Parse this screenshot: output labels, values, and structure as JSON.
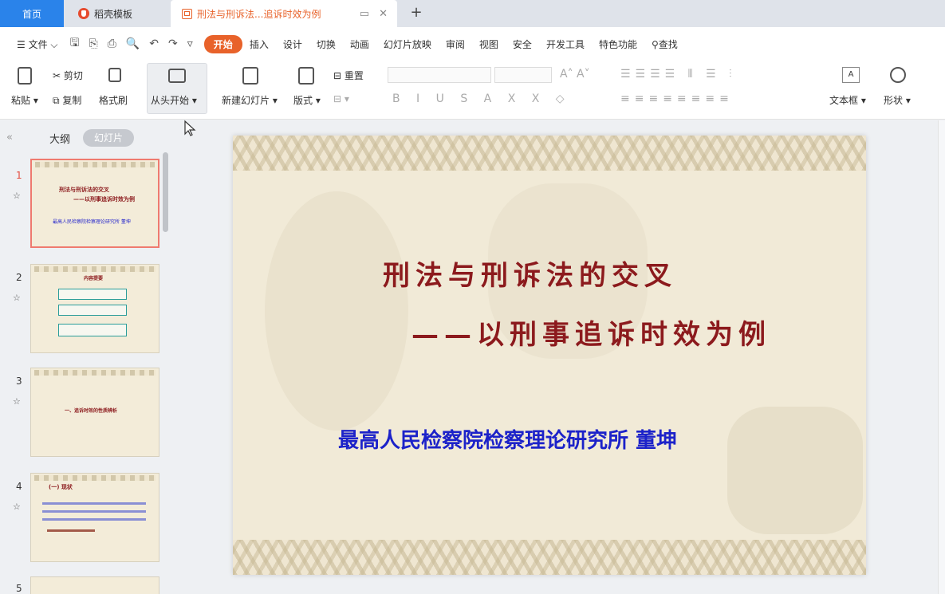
{
  "tabs": {
    "home": "首页",
    "templates": "稻壳模板",
    "doc": "刑法与刑诉法...追诉时效为例",
    "add": "+"
  },
  "menu": {
    "file": "文件",
    "items": [
      "开始",
      "插入",
      "设计",
      "切换",
      "动画",
      "幻灯片放映",
      "审阅",
      "视图",
      "安全",
      "开发工具",
      "特色功能"
    ],
    "search": "查找"
  },
  "ribbon": {
    "paste": "粘贴",
    "cut": "剪切",
    "copy": "复制",
    "format_painter": "格式刷",
    "from_start": "从头开始",
    "new_slide": "新建幻灯片",
    "layout": "版式",
    "reset": "重置",
    "text_box": "文本框",
    "shape": "形状"
  },
  "left_panel": {
    "outline": "大纲",
    "slides": "幻灯片",
    "numbers": [
      "1",
      "2",
      "3",
      "4",
      "5"
    ]
  },
  "slide": {
    "title_line1": "刑法与刑诉法的交叉",
    "title_line2": "——以刑事追诉时效为例",
    "author": "最高人民检察院检察理论研究所 董坤"
  },
  "thumbs": {
    "t1_l1": "刑法与刑诉法的交叉",
    "t1_l2": "——以刑事追诉时效为例",
    "t1_l3": "最高人民检察院检察理论研究所 董坤",
    "t2_title": "内容提要",
    "t3_text": "一、追诉时效的性质辨析",
    "t4_title": "(一) 现状"
  }
}
